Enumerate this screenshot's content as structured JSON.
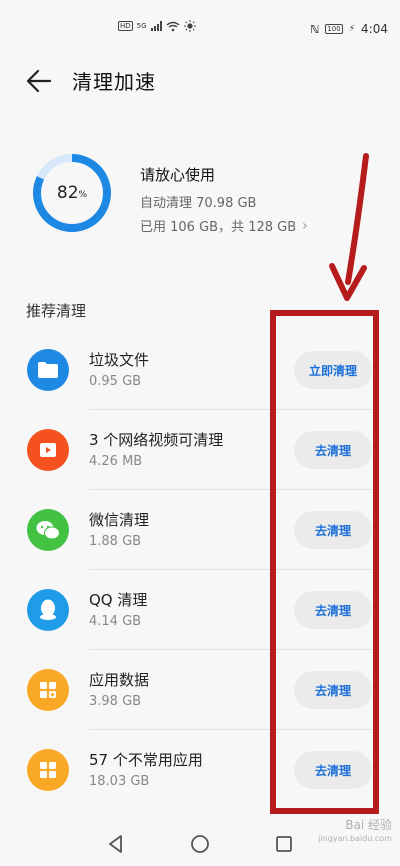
{
  "status_bar": {
    "network_badge": "HD",
    "network_gen": "5G",
    "battery_level": "100",
    "time": "4:04"
  },
  "header": {
    "title": "清理加速"
  },
  "storage": {
    "percent_value": "82",
    "percent_sign": "%",
    "percent_fraction": 0.82,
    "status_text": "请放心使用",
    "auto_clean_text": "自动清理 70.98 GB",
    "usage_text": "已用 106 GB，共 128 GB"
  },
  "section_title": "推荐清理",
  "items": [
    {
      "name": "垃圾文件",
      "size": "0.95 GB",
      "action": "立即清理",
      "icon": "folder-icon",
      "color": "#1e88e5"
    },
    {
      "name": "3 个网络视频可清理",
      "size": "4.26 MB",
      "action": "去清理",
      "icon": "video-play-icon",
      "color": "#f4511e"
    },
    {
      "name": "微信清理",
      "size": "1.88 GB",
      "action": "去清理",
      "icon": "wechat-icon",
      "color": "#43c143"
    },
    {
      "name": "QQ 清理",
      "size": "4.14 GB",
      "action": "去清理",
      "icon": "qq-penguin-icon",
      "color": "#1e9be9"
    },
    {
      "name": "应用数据",
      "size": "3.98 GB",
      "action": "去清理",
      "icon": "app-data-icon",
      "color": "#f9a825"
    },
    {
      "name": "57 个不常用应用",
      "size": "18.03 GB",
      "action": "去清理",
      "icon": "apps-grid-icon",
      "color": "#f9a825"
    }
  ],
  "colors": {
    "accent": "#1a6fd8",
    "ring": "#1e88e5",
    "ring_track": "#d7e8fb",
    "annotation": "#b71c1c"
  },
  "watermark": {
    "main": "Bai 经验",
    "sub": "jingyan.baidu.com"
  }
}
